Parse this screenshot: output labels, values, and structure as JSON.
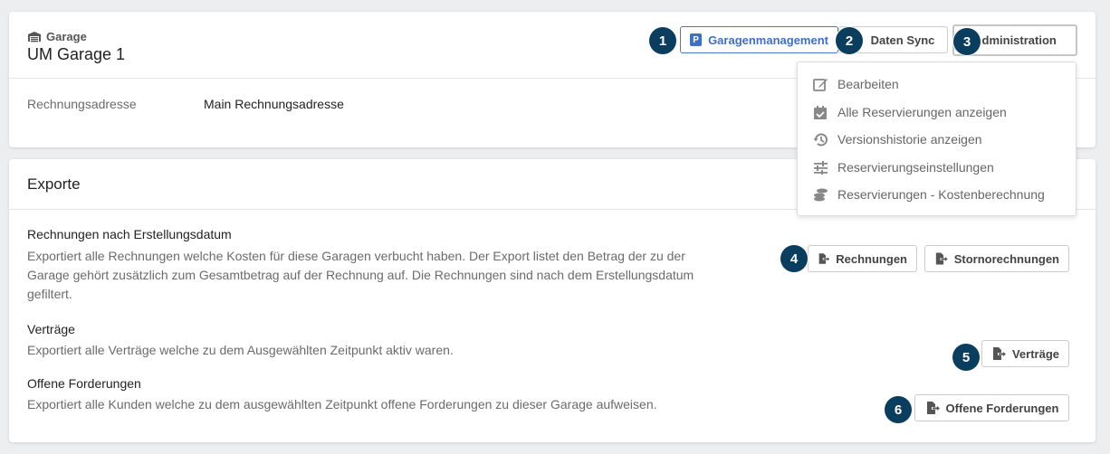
{
  "garage": {
    "label": "Garage",
    "title": "UM Garage 1",
    "billing_label": "Rechnungsadresse",
    "billing_value": "Main Rechnungsadresse"
  },
  "header_buttons": {
    "garagenmanagement": "Garagenmanagement",
    "daten_sync": "Daten Sync",
    "administration": "Administration"
  },
  "badges": [
    "1",
    "2",
    "3",
    "4",
    "5",
    "6"
  ],
  "dropdown": {
    "items": [
      {
        "label": "Bearbeiten",
        "icon": "edit-icon"
      },
      {
        "label": "Alle Reservierungen anzeigen",
        "icon": "calendar-check-icon"
      },
      {
        "label": "Versionshistorie anzeigen",
        "icon": "history-icon"
      },
      {
        "label": "Reservierungseinstellungen",
        "icon": "sliders-icon"
      },
      {
        "label": "Reservierungen - Kostenberechnung",
        "icon": "coins-icon"
      }
    ]
  },
  "exports": {
    "title": "Exporte",
    "sections": [
      {
        "heading": "Rechnungen nach Erstellungsdatum",
        "description": "Exportiert alle Rechnungen welche Kosten für diese Garagen verbucht haben. Der Export listet den Betrag der zu der Garage gehört zusätzlich zum Gesamtbetrag auf der Rechnung auf. Die Rechnungen sind nach dem Erstellungsdatum gefiltert.",
        "buttons": [
          "Rechnungen",
          "Stornorechnungen"
        ]
      },
      {
        "heading": "Verträge",
        "description": "Exportiert alle Verträge welche zu dem Ausgewählten Zeitpunkt aktiv waren.",
        "buttons": [
          "Verträge"
        ]
      },
      {
        "heading": "Offene Forderungen",
        "description": "Exportiert alle Kunden welche zu dem ausgewählten Zeitpunkt offene Forderungen zu dieser Garage aufweisen.",
        "buttons": [
          "Offene Forderungen"
        ]
      }
    ]
  },
  "colors": {
    "badge": "#0b3d5e",
    "accent": "#3f6fbf",
    "background": "#edeef0"
  }
}
